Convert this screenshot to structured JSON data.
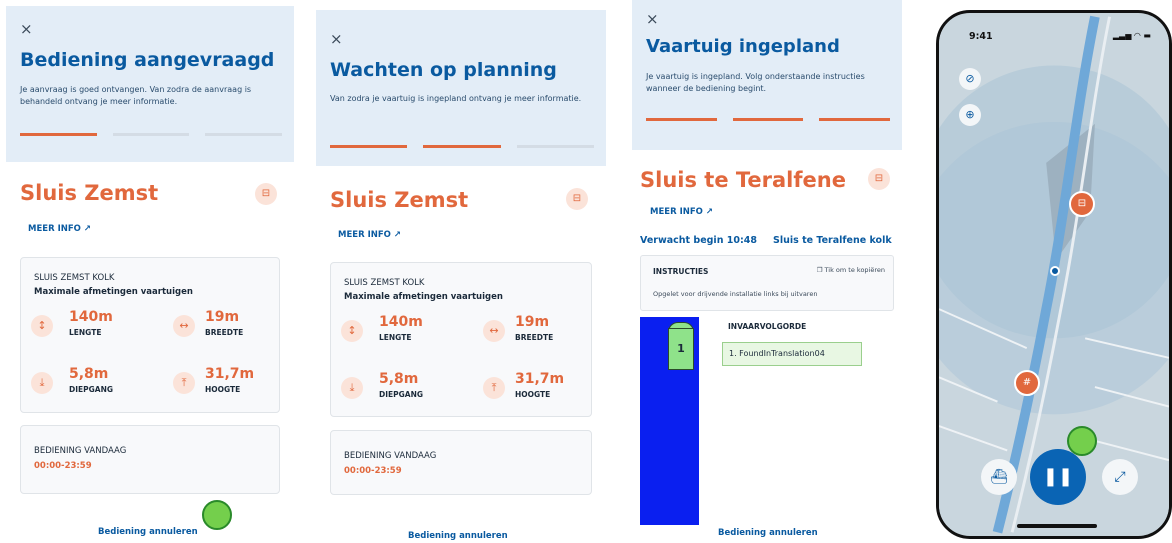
{
  "screen1": {
    "close_icon": "×",
    "header_title": "Bediening aangevraagd",
    "header_desc": "Je aanvraag is goed ontvangen. Van zodra de aanvraag is behandeld ontvang je meer informatie.",
    "progress_active_steps": 1,
    "progress_total_steps": 3,
    "lock_name": "Sluis Zemst",
    "meer_info": "MEER INFO",
    "kolk_name": "SLUIS ZEMST KOLK",
    "kolk_subtitle": "Maximale afmetingen vaartuigen",
    "lengte_value": "140m",
    "lengte_label": "LENGTE",
    "breedte_value": "19m",
    "breedte_label": "BREEDTE",
    "diepgang_value": "5,8m",
    "diepgang_label": "DIEPGANG",
    "hoogte_value": "31,7m",
    "hoogte_label": "HOOGTE",
    "bediening_title": "BEDIENING VANDAAG",
    "bediening_time": "00:00-23:59",
    "cancel_label": "Bediening annuleren"
  },
  "screen2": {
    "close_icon": "×",
    "header_title": "Wachten op planning",
    "header_desc": "Van zodra je vaartuig is ingepland ontvang je meer informatie.",
    "progress_active_steps": 2,
    "progress_total_steps": 3,
    "lock_name": "Sluis Zemst",
    "meer_info": "MEER INFO",
    "kolk_name": "SLUIS ZEMST KOLK",
    "kolk_subtitle": "Maximale afmetingen vaartuigen",
    "lengte_value": "140m",
    "lengte_label": "LENGTE",
    "breedte_value": "19m",
    "breedte_label": "BREEDTE",
    "diepgang_value": "5,8m",
    "diepgang_label": "DIEPGANG",
    "hoogte_value": "31,7m",
    "hoogte_label": "HOOGTE",
    "bediening_title": "BEDIENING VANDAAG",
    "bediening_time": "00:00-23:59",
    "cancel_label": "Bediening annuleren"
  },
  "screen3": {
    "close_icon": "×",
    "header_title": "Vaartuig ingepland",
    "header_desc": "Je vaartuig is ingepland. Volg onderstaande instructies wanneer de bediening begint.",
    "progress_active_steps": 3,
    "progress_total_steps": 3,
    "lock_name": "Sluis te Teralfene",
    "meer_info": "MEER INFO",
    "expected_start": "Verwacht begin 10:48",
    "kolk_name": "Sluis te Teralfene kolk",
    "instructions_title": "INSTRUCTIES",
    "copy_hint": "Tik om te kopiëren",
    "instructions_text": "Opgelet voor drijvende installatie links bij uitvaren",
    "vessel_number": "1",
    "order_title": "INVAARVOLGORDE",
    "order_items": [
      "1. FoundInTranslation04"
    ],
    "cancel_label": "Bediening annuleren"
  },
  "phone": {
    "status_time": "9:41",
    "status_icons": "signal-wifi-battery",
    "buttons": [
      "compass-icon",
      "location-target-icon",
      "vessel-icon",
      "pause-icon",
      "expand-icon"
    ]
  },
  "colors": {
    "brand_blue": "#0a5aa0",
    "accent_orange": "#e1683d",
    "header_bg": "#e3edf7",
    "lock_water": "#0a1ff0",
    "vessel_green": "#8fe28a",
    "tap_indicator": "#74cf4c"
  }
}
